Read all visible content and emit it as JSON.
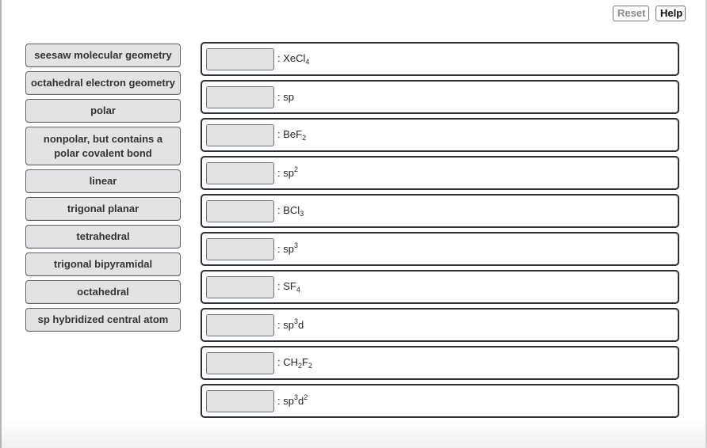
{
  "toolbar": {
    "reset_label": "Reset",
    "help_label": "Help"
  },
  "labels": [
    "seesaw molecular geometry",
    "octahedral electron geometry",
    "polar",
    "nonpolar, but contains a polar covalent bond",
    "linear",
    "trigonal planar",
    "tetrahedral",
    "trigonal bipyramidal",
    "octahedral",
    "sp hybridized central atom"
  ],
  "targets": [
    {
      "prefix": ": ",
      "parts": [
        {
          "t": "XeCl"
        },
        {
          "sub": "4"
        }
      ],
      "value": ""
    },
    {
      "prefix": ": ",
      "parts": [
        {
          "t": "sp"
        }
      ],
      "value": ""
    },
    {
      "prefix": ": ",
      "parts": [
        {
          "t": "BeF"
        },
        {
          "sub": "2"
        }
      ],
      "value": ""
    },
    {
      "prefix": ": ",
      "parts": [
        {
          "t": "sp"
        },
        {
          "sup": "2"
        }
      ],
      "value": ""
    },
    {
      "prefix": ": ",
      "parts": [
        {
          "t": "BCl"
        },
        {
          "sub": "3"
        }
      ],
      "value": ""
    },
    {
      "prefix": ": ",
      "parts": [
        {
          "t": "sp"
        },
        {
          "sup": "3"
        }
      ],
      "value": ""
    },
    {
      "prefix": ": ",
      "parts": [
        {
          "t": "SF"
        },
        {
          "sub": "4"
        }
      ],
      "value": ""
    },
    {
      "prefix": ": ",
      "parts": [
        {
          "t": "sp"
        },
        {
          "sup": "3"
        },
        {
          "t": "d"
        }
      ],
      "value": ""
    },
    {
      "prefix": ": ",
      "parts": [
        {
          "t": "CH"
        },
        {
          "sub": "2"
        },
        {
          "t": "F"
        },
        {
          "sub": "2"
        }
      ],
      "value": ""
    },
    {
      "prefix": ": ",
      "parts": [
        {
          "t": "sp"
        },
        {
          "sup": "3"
        },
        {
          "t": "d"
        },
        {
          "sup": "2"
        }
      ],
      "value": ""
    }
  ]
}
